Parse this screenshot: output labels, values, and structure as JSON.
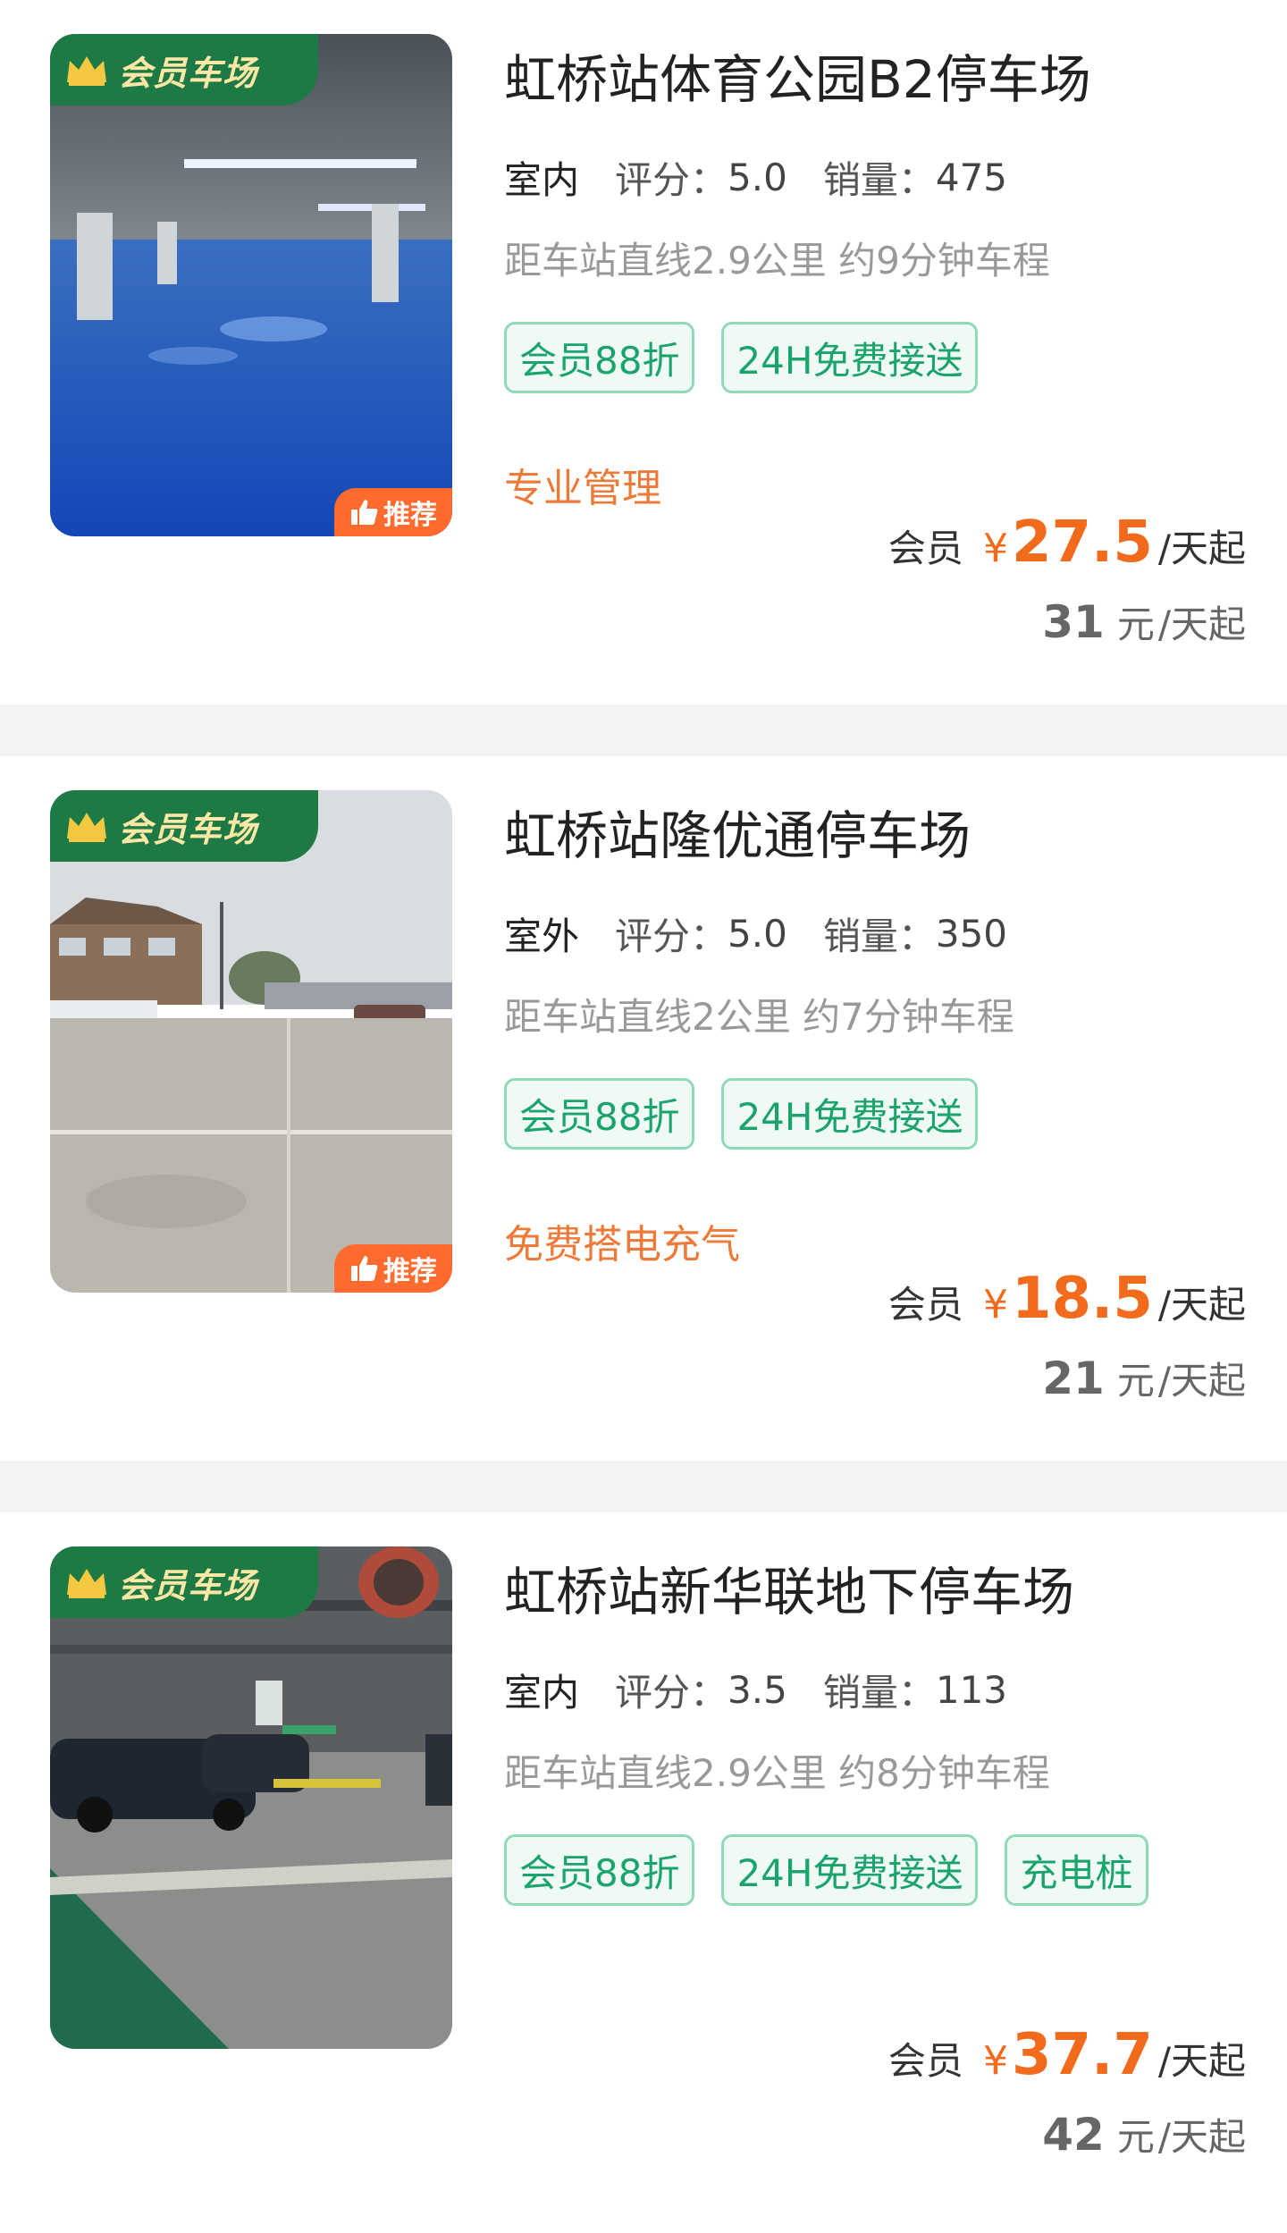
{
  "common": {
    "vip_badge": "会员车场",
    "recommend_badge": "推荐",
    "rating_label": "评分：",
    "sales_label": "销量：",
    "price_prefix": "会员",
    "currency": "¥",
    "per_day_unit": "/天起",
    "yuan": "元"
  },
  "lots": [
    {
      "name": "虹桥站体育公园B2停车场",
      "type": "室内",
      "rating": "5.0",
      "sales": "475",
      "distance": "距车站直线2.9公里 约9分钟车程",
      "tags": [
        "会员88折",
        "24H免费接送"
      ],
      "feature": "专业管理",
      "member_price": "27.5",
      "original_price": "31",
      "recommended": true,
      "photo": "indoor-blue-floor-garage"
    },
    {
      "name": "虹桥站隆优通停车场",
      "type": "室外",
      "rating": "5.0",
      "sales": "350",
      "distance": "距车站直线2公里 约7分钟车程",
      "tags": [
        "会员88折",
        "24H免费接送"
      ],
      "feature": "免费搭电充气",
      "member_price": "18.5",
      "original_price": "21",
      "recommended": true,
      "photo": "outdoor-concrete-lot"
    },
    {
      "name": "虹桥站新华联地下停车场",
      "type": "室内",
      "rating": "3.5",
      "sales": "113",
      "distance": "距车站直线2.9公里 约8分钟车程",
      "tags": [
        "会员88折",
        "24H免费接送",
        "充电桩"
      ],
      "feature": "",
      "member_price": "37.7",
      "original_price": "42",
      "recommended": false,
      "photo": "underground-green-floor-garage"
    }
  ],
  "colors": {
    "vip_green": "#1e7a45",
    "vip_gold": "#ffe7a6",
    "tag_green": "#1aa36b",
    "price_orange": "#f26a1b",
    "feature_orange": "#ee7a3a",
    "recommend_orange": "#ff6a2f"
  }
}
